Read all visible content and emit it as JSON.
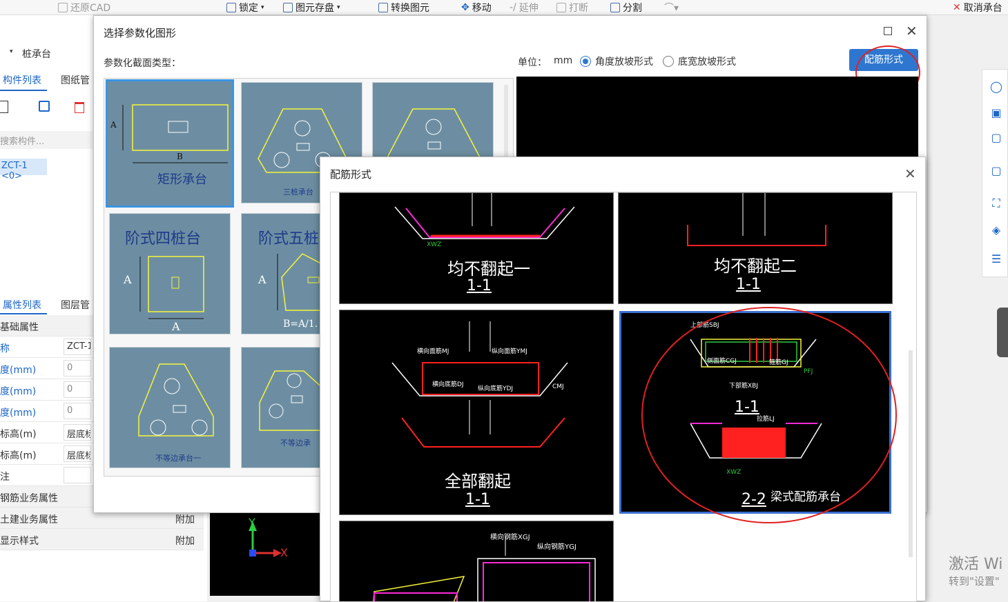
{
  "toolbar": {
    "restore_cad": "还原CAD",
    "lock": "锁定",
    "save_element": "图元存盘",
    "convert": "转换图元",
    "move": "移动",
    "extend": "延伸",
    "break": "打断",
    "split": "分割",
    "cancel": "取消承台"
  },
  "left_panel": {
    "category": "桩承台",
    "tab_component_list": "构件列表",
    "tab_drawing": "图纸管",
    "search_placeholder": "搜索构件...",
    "component": "ZCT-1 <0>",
    "tab_property_list": "属性列表",
    "tab_layer": "图层管",
    "properties": [
      {
        "key": "基础属性",
        "value": "",
        "section": true
      },
      {
        "key": "称",
        "value": "ZCT-1"
      },
      {
        "key": "度(mm)",
        "value": "0"
      },
      {
        "key": "度(mm)",
        "value": "0"
      },
      {
        "key": "度(mm)",
        "value": "0"
      },
      {
        "key": "标高(m)",
        "value": "层底标"
      },
      {
        "key": "标高(m)",
        "value": "层底标"
      },
      {
        "key": "注",
        "value": ""
      },
      {
        "key": "钢筋业务属性",
        "value": "",
        "section": true
      },
      {
        "key": "土建业务属性",
        "value": "附加",
        "section": true
      },
      {
        "key": "显示样式",
        "value": "附加",
        "section": true
      }
    ],
    "axis_y": "Y",
    "axis_x": "X"
  },
  "dialog1": {
    "title": "选择参数化图形",
    "section_label": "参数化截面类型：",
    "unit_label": "单位：",
    "unit_value": "mm",
    "radio_angle": "角度放坡形式",
    "radio_width": "底宽放坡形式",
    "rebar_button": "配筋形式",
    "cards": {
      "c1_label": "矩形承台",
      "c1_a": "A",
      "c1_b": "B",
      "c2_label": "三桩承台",
      "c3_label": "",
      "c4_label": "阶式四桩台",
      "c4_a": "A",
      "c4_a2": "A",
      "c5_label": "阶式五桩",
      "c5_a": "A",
      "c5_b": "B=A/1.",
      "c7_label": "不等边承台一",
      "c8_label": "不等边承"
    }
  },
  "dialog2": {
    "title": "配筋形式",
    "panels": [
      {
        "title": "均不翻起一",
        "sub": "1-1",
        "tag": "XWZ"
      },
      {
        "title": "均不翻起二",
        "sub": "1-1"
      },
      {
        "title": "全部翻起",
        "sub": "1-1",
        "labels": [
          "横向面筋MJ",
          "纵向面筋YMJ",
          "横向底筋DJ",
          "纵向底筋YDJ",
          "CMJ"
        ]
      },
      {
        "title": "梁式配筋承台",
        "sub1": "1-1",
        "sub2": "2-2",
        "labels": [
          "上部筋SBJ",
          "侧面筋CGJ",
          "下部筋XBJ",
          "箍筋GJ",
          "PFJ",
          "拉筋LJ",
          "XWZ"
        ]
      },
      {
        "title": "",
        "labels": [
          "横向钢筋XGJ",
          "纵向钢筋YGJ"
        ]
      }
    ]
  },
  "watermark": {
    "line1": "激活 Wi",
    "line2": "转到\"设置\""
  },
  "colors": {
    "accent": "#2e77d0",
    "annotation": "#e02020",
    "card_bg": "#6d8ea2"
  }
}
